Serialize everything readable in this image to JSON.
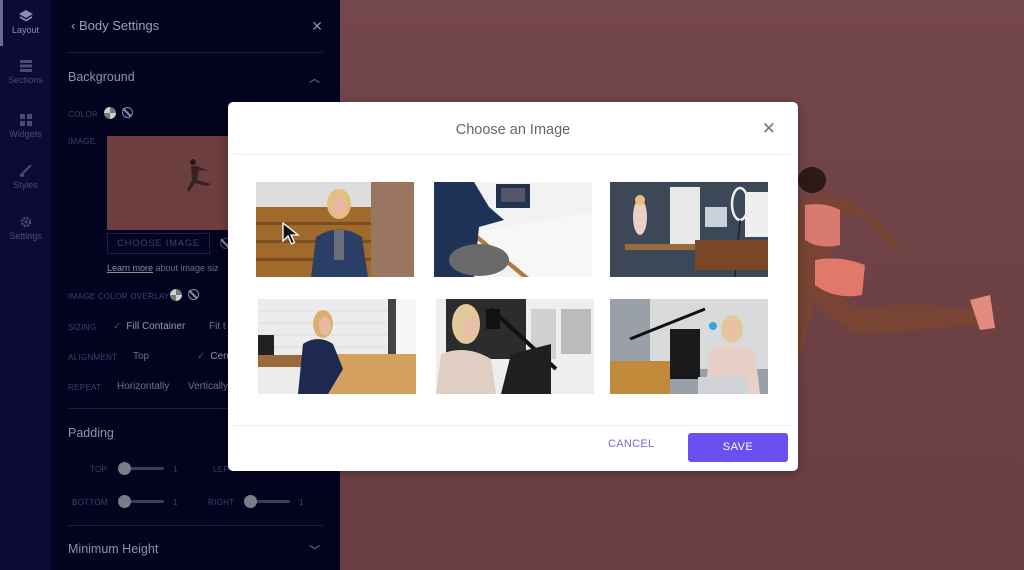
{
  "rail": {
    "items": [
      {
        "label": "Layout",
        "icon": "layers-icon",
        "active": true
      },
      {
        "label": "Sections",
        "icon": "sections-icon"
      },
      {
        "label": "Widgets",
        "icon": "widgets-icon"
      },
      {
        "label": "Styles",
        "icon": "brush-icon"
      },
      {
        "label": "Settings",
        "icon": "gear-icon"
      }
    ]
  },
  "panel": {
    "title": "Body Settings",
    "back_icon": "chevron-left-icon",
    "close_icon": "close-icon",
    "background": {
      "title": "Background",
      "color_label": "COLOR",
      "image_label": "IMAGE",
      "choose_image_label": "CHOOSE IMAGE",
      "learn_more_link": "Learn more",
      "learn_more_rest": " about image siz",
      "overlay_label": "IMAGE COLOR OVERLAY",
      "sizing_label": "SIZING",
      "sizing_options": [
        "Fill Container",
        "Fit t"
      ],
      "sizing_selected": "Fill Container",
      "alignment_label": "ALIGNMENT",
      "alignment_options": [
        "Top",
        "Cen"
      ],
      "alignment_selected": "Cen",
      "repeat_label": "REPEAT",
      "repeat_options": [
        "Horizontally",
        "Vertically"
      ]
    },
    "padding": {
      "title": "Padding",
      "top_label": "TOP",
      "top_value": "1",
      "left_label": "LEF",
      "bottom_label": "BOTTOM",
      "bottom_value": "1",
      "right_label": "RIGHT",
      "right_value": "1"
    },
    "min_height": {
      "title": "Minimum Height"
    }
  },
  "modal": {
    "title": "Choose an Image",
    "close_icon": "close-icon",
    "images": [
      {
        "desc": "Smiling woman in denim jacket at wooden wall"
      },
      {
        "desc": "Woman at desk working on laptop"
      },
      {
        "desc": "Woman in home studio with ring light"
      },
      {
        "desc": "Woman writing at desk by white brick wall"
      },
      {
        "desc": "Woman with headphones at microphone"
      },
      {
        "desc": "Woman with headset at laptop and mic"
      }
    ],
    "cancel_label": "CANCEL",
    "save_label": "SAVE",
    "accent": "#6b4ff1"
  }
}
